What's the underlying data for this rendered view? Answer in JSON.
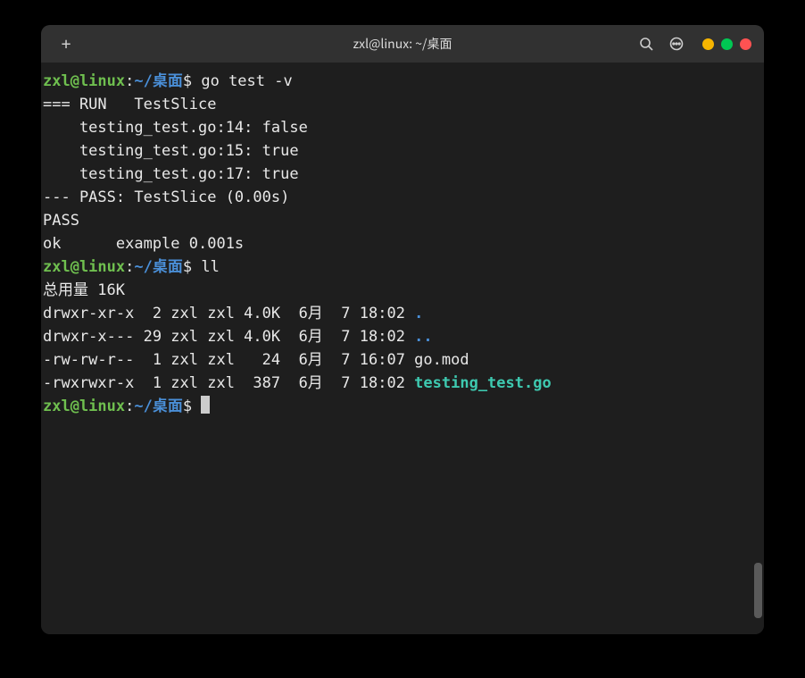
{
  "titlebar": {
    "new_tab_symbol": "+",
    "title": "zxl@linux: ~/桌面"
  },
  "colors": {
    "prompt_user": "#6fbf4f",
    "prompt_path": "#4a8fd8",
    "executable": "#3ec9b0",
    "dir_link": "#4a8fd8",
    "traffic_yellow": "#f7b500",
    "traffic_green": "#00c853",
    "traffic_red": "#ff5252"
  },
  "prompt": {
    "user_host": "zxl@linux",
    "separator": ":",
    "path": "~/桌面",
    "symbol": "$"
  },
  "commands": {
    "cmd1": "go test -v",
    "cmd2": "ll"
  },
  "output": {
    "run_line": "=== RUN   TestSlice",
    "log1": "    testing_test.go:14: false",
    "log2": "    testing_test.go:15: true",
    "log3": "    testing_test.go:17: true",
    "pass_line": "--- PASS: TestSlice (0.00s)",
    "pass": "PASS",
    "ok": "ok      example 0.001s",
    "ll_header": "总用量 16K",
    "ll_row1_pre": "drwxr-xr-x  2 zxl zxl 4.0K  6月  7 18:02 ",
    "ll_row1_name": ".",
    "ll_row2_pre": "drwxr-x--- 29 zxl zxl 4.0K  6月  7 18:02 ",
    "ll_row2_name": "..",
    "ll_row3_pre": "-rw-rw-r--  1 zxl zxl   24  6月  7 16:07 ",
    "ll_row3_name": "go.mod",
    "ll_row4_pre": "-rwxrwxr-x  1 zxl zxl  387  6月  7 18:02 ",
    "ll_row4_name": "testing_test.go"
  }
}
